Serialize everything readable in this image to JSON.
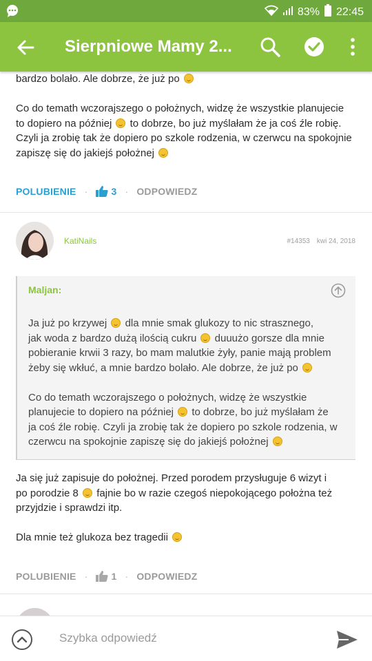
{
  "status_bar": {
    "battery": "83%",
    "time": "22:45"
  },
  "app_bar": {
    "title": "Sierpniowe Mamy 2..."
  },
  "post1": {
    "text_tail": "bardzo bolało. Ale dobrze, że już po",
    "para2_a": "Co do temath wczorajszego o położnych, widzę że wszystkie planujecie",
    "para2_b_pre": "to dopiero na później",
    "para2_b_post": "to dobrze, bo już myślałam że ja coś źle robię.",
    "para2_c": "Czyli ja zrobię tak że dopiero po szkole rodzenia, w czerwcu na spokojnie",
    "para2_d": "zapiszę się do jakiejś położnej",
    "like_label": "POLUBIENIE",
    "like_count": "3",
    "reply_label": "ODPOWIEDZ"
  },
  "post2": {
    "author": "KatiNails",
    "post_id": "#14353",
    "date": "kwi 24, 2018",
    "quote": {
      "author": "Maljan:",
      "l1a": "Ja już po krzywej",
      "l1b": "dla mnie smak glukozy to nic strasznego,",
      "l2a": "jak woda z bardzo dużą ilością cukru",
      "l2b": "duuużo gorsze dla mnie",
      "l3": "pobieranie krwii 3 razy, bo mam malutkie żyły, panie mają problem",
      "l4": "żeby się wkłuć, a mnie bardzo bolało. Ale dobrze, że już po",
      "l5": "Co do temath wczorajszego o położnych, widzę że wszystkie",
      "l6a": "planujecie to dopiero na później",
      "l6b": "to dobrze, bo już myślałam że",
      "l7": "ja coś źle robię. Czyli ja zrobię tak że dopiero po szkole rodzenia, w",
      "l8": "czerwcu na spokojnie zapiszę się do jakiejś położnej"
    },
    "body1": "Ja się już zapisuje do położnej. Przed porodem przysługuje 6 wizyt i",
    "body2a": "po porodzie 8",
    "body2b": "fajnie bo w razie czegoś niepokojącego położna też",
    "body3": "przyjdzie i sprawdzi itp.",
    "body4": "Dla mnie też glukoza bez tragedii",
    "like_label": "POLUBIENIE",
    "like_count": "1",
    "reply_label": "ODPOWIEDZ"
  },
  "bottom_bar": {
    "placeholder": "Szybka odpowiedź"
  },
  "colors": {
    "accent": "#8cc43f",
    "status": "#6fa83c",
    "link_blue": "#2a9fd0"
  }
}
